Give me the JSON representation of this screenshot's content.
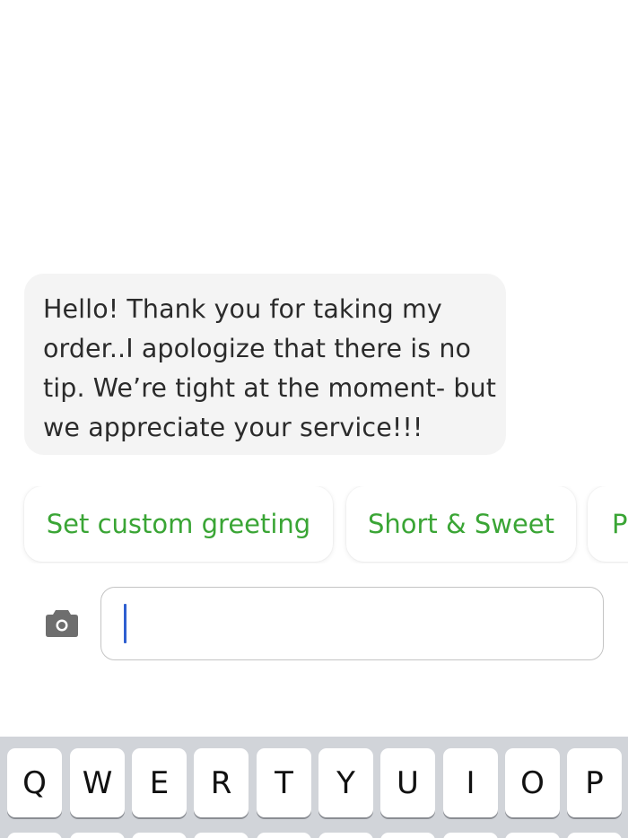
{
  "conversation": {
    "message_lines": [
      "Hello! Thank you for taking my",
      "order..I apologize that there is no",
      "tip. We’re tight at the moment- but",
      "we appreciate your service!!!"
    ]
  },
  "quick_replies": [
    {
      "label": "Set custom greeting"
    },
    {
      "label": "Short & Sweet"
    },
    {
      "label": "P"
    }
  ],
  "composer": {
    "input_value": "",
    "camera_icon": "camera-icon"
  },
  "keyboard": {
    "row1": [
      "Q",
      "W",
      "E",
      "R",
      "T",
      "Y",
      "U",
      "I",
      "O",
      "P"
    ]
  },
  "colors": {
    "chip_text": "#3aa535",
    "bubble_bg": "#f4f4f4",
    "caret": "#2f5fd0",
    "keyboard_bg": "#d1d4d9"
  }
}
